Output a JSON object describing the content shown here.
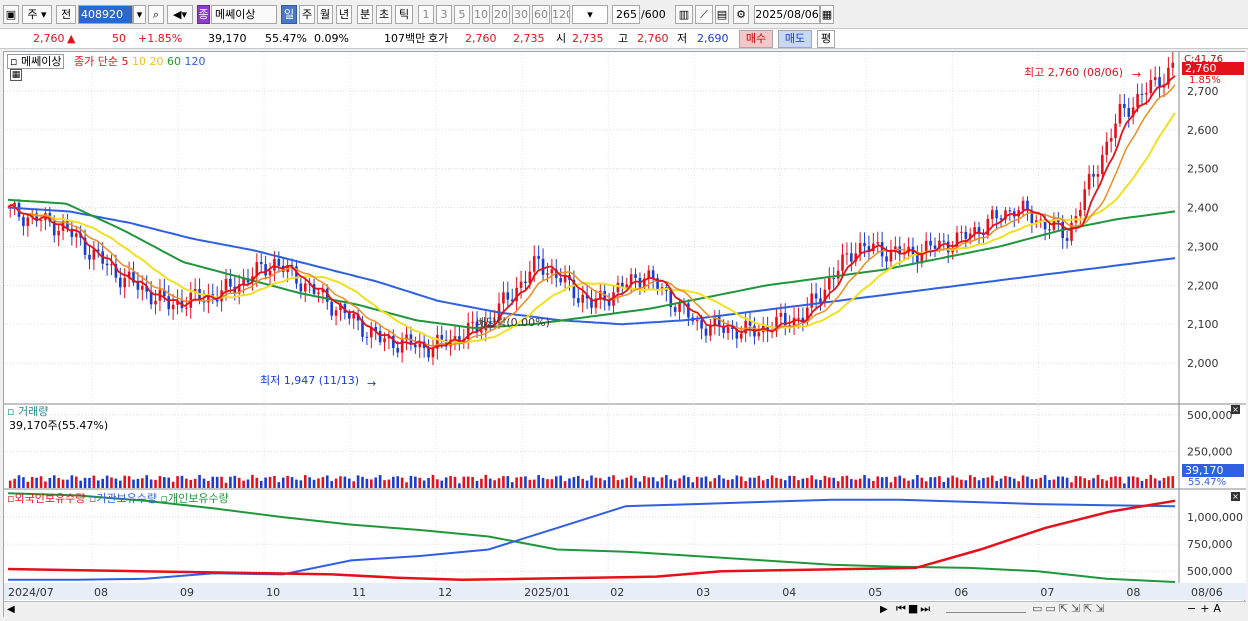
{
  "toolbar": {
    "market": "주",
    "prev_label": "전",
    "code": "408920",
    "stock_badge": "종",
    "stock_name": "메쎄이상",
    "period_day": "일",
    "period_week": "주",
    "period_month": "월",
    "period_year": "년",
    "period_minute": "분",
    "period_second": "초",
    "period_tick": "틱",
    "intervals": [
      "1",
      "3",
      "5",
      "10",
      "20",
      "30",
      "60",
      "120"
    ],
    "count": "265",
    "count_total": "/600",
    "date": "2025/08/06"
  },
  "info": {
    "price": "2,760",
    "arrow": "▲",
    "change": "50",
    "change_pct": "+1.85%",
    "volume": "39,170",
    "volume_ratio": "55.47%",
    "turnover": "0.09%",
    "amount": "107백만",
    "ask_label": "호가",
    "ask": "2,760",
    "bid": "2,735",
    "open_label": "시",
    "open": "2,735",
    "high_label": "고",
    "high": "2,760",
    "low_label": "저",
    "low": "2,690",
    "buy_label": "매수",
    "sell_label": "매도",
    "avg_label": "평"
  },
  "legend": {
    "stock": "메쎄이상",
    "ma_title": "종가 단순",
    "ma5": "5",
    "ma10": "10",
    "ma20": "20",
    "ma60": "60",
    "ma120": "120"
  },
  "annotations": {
    "high": "최고 2,760 (08/06)",
    "low": "최저 1,947 (11/13)",
    "dividend": "배당락(0.00%)",
    "corner_top": "C:41.76",
    "current_price_tag": "2,760",
    "current_pct_tag": "1.85%"
  },
  "volume_panel": {
    "title": "거래량",
    "value": "39,170주(55.47%)",
    "tag_value": "39,170",
    "tag_pct": "55.47%"
  },
  "holdings_panel": {
    "titles": [
      "외국인보유수량",
      "기관보유수량",
      "개인보유수량"
    ]
  },
  "colors": {
    "up": "#e4111b",
    "down": "#1a3cd0",
    "ma5": "#e4111b",
    "ma10": "#f08c20",
    "ma20": "#f0e020",
    "ma60": "#20963c",
    "ma120": "#3060e0",
    "foreign": "#e4111b",
    "institution": "#3060e0",
    "individual": "#20963c"
  },
  "chart_data": {
    "type": "candlestick",
    "price_axis": {
      "ticks": [
        "2,700",
        "2,600",
        "2,500",
        "2,400",
        "2,300",
        "2,200",
        "2,100",
        "2,000"
      ],
      "ylim": [
        1900,
        2800
      ]
    },
    "volume_axis": {
      "ticks": [
        "500,000",
        "250,000"
      ],
      "ylim": [
        0,
        560000
      ]
    },
    "holdings_axis": {
      "ticks": [
        "1,000,000",
        "750,000",
        "500,000"
      ],
      "ylim": [
        400000,
        1250000
      ]
    },
    "x_labels": [
      "2024/07",
      "08",
      "09",
      "10",
      "11",
      "12",
      "2025/01",
      "02",
      "03",
      "04",
      "05",
      "06",
      "07",
      "08",
      "08/06"
    ],
    "months": [
      "2024/07",
      "2024/08",
      "2024/09",
      "2024/10",
      "2024/11",
      "2024/12",
      "2025/01",
      "2025/02",
      "2025/03",
      "2025/04",
      "2025/05",
      "2025/06",
      "2025/07",
      "2025/08"
    ],
    "close_by_period": [
      2390,
      2350,
      2230,
      2150,
      2180,
      2260,
      2160,
      2060,
      2040,
      2100,
      2260,
      2150,
      2230,
      2100,
      2080,
      2120,
      2300,
      2280,
      2320,
      2400,
      2330,
      2640,
      2760
    ],
    "ma60_by_period": [
      2420,
      2410,
      2340,
      2260,
      2220,
      2180,
      2150,
      2110,
      2090,
      2100,
      2120,
      2140,
      2170,
      2200,
      2220,
      2240,
      2270,
      2300,
      2340,
      2370,
      2390
    ],
    "ma120_by_period": [
      2400,
      2390,
      2360,
      2320,
      2290,
      2250,
      2210,
      2160,
      2130,
      2110,
      2100,
      2110,
      2130,
      2150,
      2170,
      2190,
      2210,
      2230,
      2250,
      2270
    ],
    "high": {
      "value": 2760,
      "date": "08/06"
    },
    "low": {
      "value": 1947,
      "date": "11/13"
    },
    "foreign_holdings": [
      520000,
      510000,
      500000,
      490000,
      480000,
      470000,
      440000,
      420000,
      430000,
      440000,
      450000,
      500000,
      510000,
      520000,
      530000,
      700000,
      900000,
      1050000,
      1150000
    ],
    "institution_holdings": [
      420000,
      420000,
      430000,
      480000,
      470000,
      600000,
      640000,
      700000,
      900000,
      1100000,
      1120000,
      1140000,
      1160000,
      1160000,
      1140000,
      1120000,
      1110000,
      1100000
    ],
    "individual_holdings": [
      1220000,
      1200000,
      1150000,
      1080000,
      1000000,
      930000,
      880000,
      820000,
      700000,
      680000,
      640000,
      600000,
      560000,
      540000,
      530000,
      500000,
      430000,
      400000
    ]
  }
}
